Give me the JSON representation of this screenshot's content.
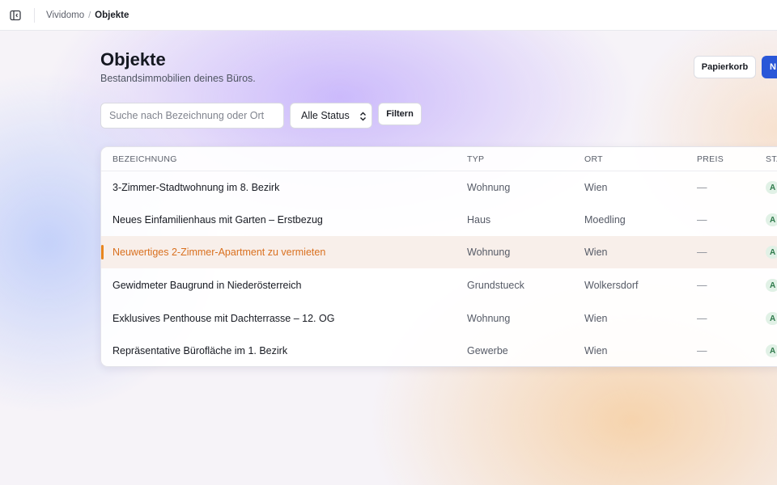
{
  "breadcrumb": {
    "root": "Vividomo",
    "separator": "/",
    "current": "Objekte"
  },
  "header": {
    "title": "Objekte",
    "subtitle": "Bestandsimmobilien deines Büros.",
    "trash_label": "Papierkorb",
    "new_label": "N"
  },
  "filters": {
    "search_placeholder": "Suche nach Bezeichnung oder Ort",
    "status_selected": "Alle Status",
    "filter_label": "Filtern"
  },
  "table": {
    "columns": [
      "BEZEICHNUNG",
      "TYP",
      "ORT",
      "PREIS",
      "STA"
    ],
    "rows": [
      {
        "name": "3-Zimmer-Stadtwohnung im 8. Bezirk",
        "type": "Wohnung",
        "location": "Wien",
        "price": "—",
        "status": "A"
      },
      {
        "name": "Neues Einfamilienhaus mit Garten – Erstbezug",
        "type": "Haus",
        "location": "Moedling",
        "price": "—",
        "status": "A"
      },
      {
        "name": "Neuwertiges 2-Zimmer-Apartment zu vermieten",
        "type": "Wohnung",
        "location": "Wien",
        "price": "—",
        "status": "A"
      },
      {
        "name": "Gewidmeter Baugrund in Niederösterreich",
        "type": "Grundstueck",
        "location": "Wolkersdorf",
        "price": "—",
        "status": "A"
      },
      {
        "name": "Exklusives Penthouse mit Dachterrasse – 12. OG",
        "type": "Wohnung",
        "location": "Wien",
        "price": "—",
        "status": "A"
      },
      {
        "name": "Repräsentative Bürofläche im 1. Bezirk",
        "type": "Gewerbe",
        "location": "Wien",
        "price": "—",
        "status": "A"
      }
    ]
  },
  "colors": {
    "accent_blue": "#2a57d8",
    "selected_orange": "#d9701f",
    "status_green": "#2f7a4b"
  },
  "icons": {
    "sidebar_toggle": "sidebar-toggle-icon",
    "select_chevron": "chevron-updown-icon"
  }
}
